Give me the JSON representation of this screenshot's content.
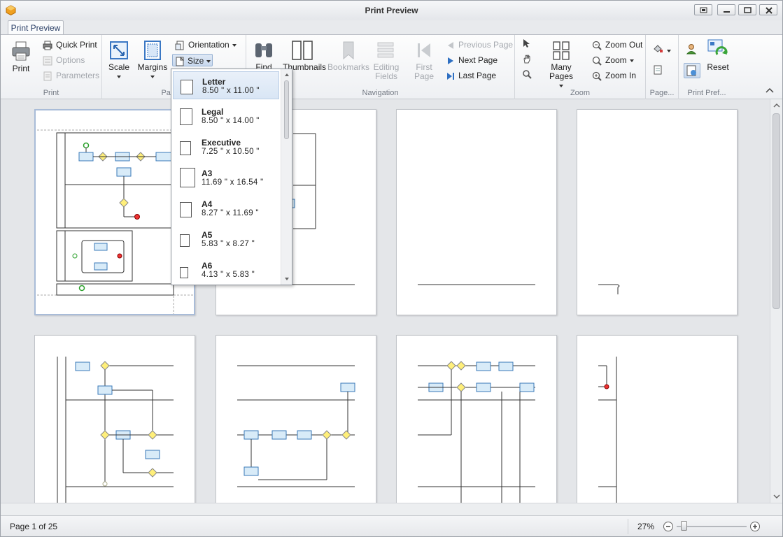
{
  "window": {
    "title": "Print Preview",
    "accent": "#2a3f66"
  },
  "tab": {
    "label": "Print Preview"
  },
  "ribbon": {
    "print_group": {
      "label": "Print",
      "print": "Print",
      "quick_print": "Quick Print",
      "options": "Options",
      "parameters": "Parameters"
    },
    "page_setup_group": {
      "label": "Page S",
      "scale": "Scale",
      "margins": "Margins",
      "orientation": "Orientation",
      "size": "Size"
    },
    "navigation_group": {
      "label": "Navigation",
      "find": "Find",
      "thumbnails": "Thumbnails",
      "bookmarks": "Bookmarks",
      "editing_fields_1": "Editing",
      "editing_fields_2": "Fields",
      "first_page_1": "First",
      "first_page_2": "Page",
      "previous_page": "Previous Page",
      "next_page": "Next Page",
      "last_page": "Last Page"
    },
    "zoom_group": {
      "label": "Zoom",
      "many_pages": "Many Pages",
      "zoom_out": "Zoom Out",
      "zoom": "Zoom",
      "zoom_in": "Zoom In"
    },
    "page_bg_group": {
      "label": "Page..."
    },
    "print_pref_group": {
      "label": "Print Pref...",
      "reset": "Reset"
    }
  },
  "size_menu": {
    "items": [
      {
        "name": "Letter",
        "dims": "8.50 \" x 11.00 \""
      },
      {
        "name": "Legal",
        "dims": "8.50 \" x 14.00 \""
      },
      {
        "name": "Executive",
        "dims": "7.25 \" x 10.50 \""
      },
      {
        "name": "A3",
        "dims": "11.69 \" x 16.54 \""
      },
      {
        "name": "A4",
        "dims": "8.27 \" x 11.69 \""
      },
      {
        "name": "A5",
        "dims": "5.83 \" x 8.27 \""
      },
      {
        "name": "A6",
        "dims": "4.13 \" x 5.83 \""
      }
    ]
  },
  "status": {
    "page_info": "Page 1 of 25",
    "zoom_level": "27%"
  }
}
